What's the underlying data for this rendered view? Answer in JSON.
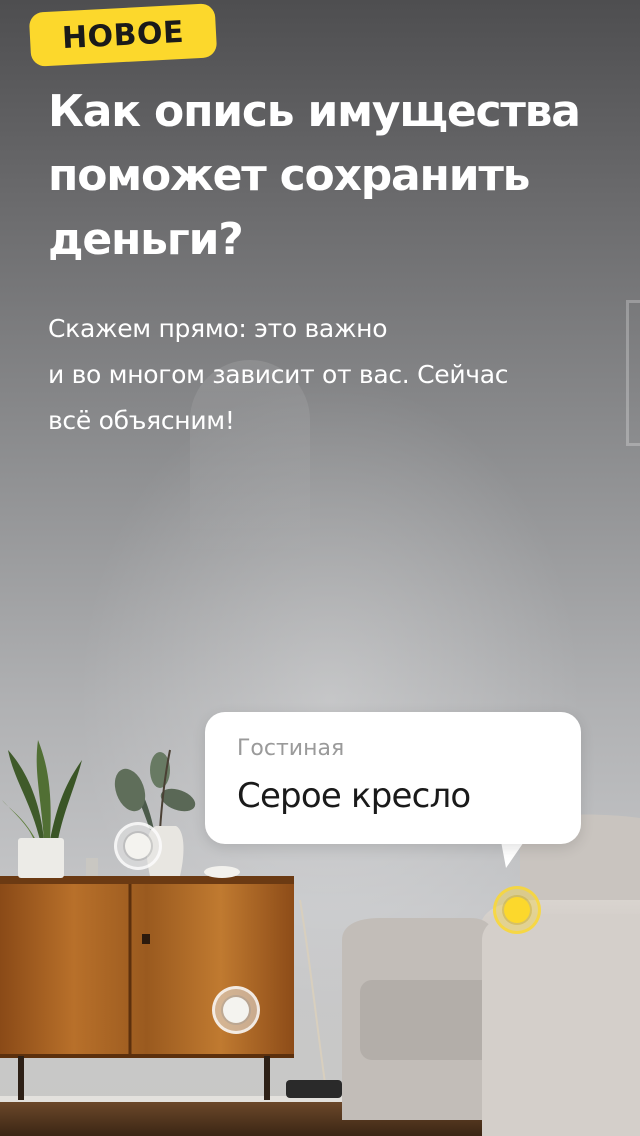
{
  "story": {
    "badge": "НОВОЕ",
    "title": "Как опись имущества поможет сохранить деньги?",
    "subtitle_lines": [
      "Скажем прямо: это важно",
      "и во многом зависит от вас. Сейчас",
      "всё объясним!"
    ]
  },
  "tooltip": {
    "room": "Гостиная",
    "item": "Серое кресло"
  },
  "colors": {
    "accent": "#fcd82c",
    "text_light": "#ffffff",
    "tooltip_bg": "#ffffff",
    "tooltip_caption": "#9a9a9a",
    "tooltip_text": "#1a1a1a"
  }
}
